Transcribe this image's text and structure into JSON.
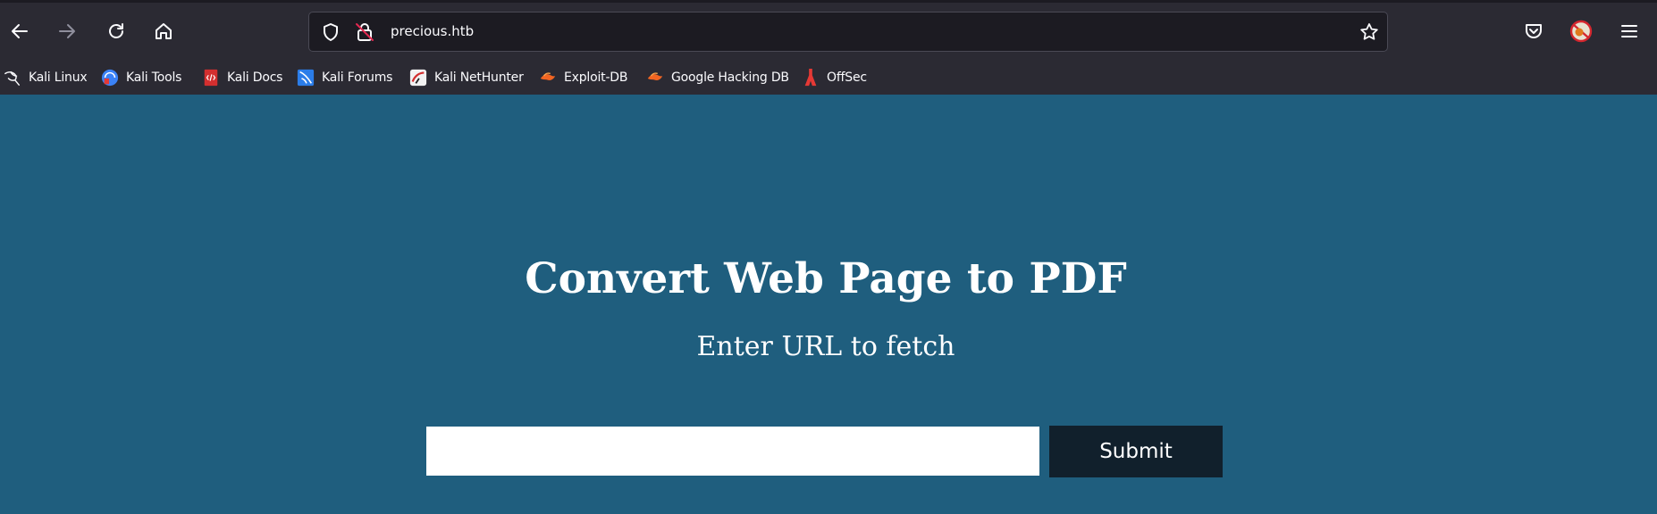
{
  "browser": {
    "url": "precious.htb",
    "icons": {
      "back": "arrow-left-icon",
      "forward": "arrow-right-icon",
      "reload": "reload-icon",
      "home": "home-icon",
      "tracking": "shield-icon",
      "connection": "insecure-lock-icon",
      "bookmark_star": "star-icon",
      "pocket": "pocket-icon",
      "extension": "extension-icon",
      "menu": "hamburger-menu-icon"
    },
    "bookmarks": [
      {
        "label": "Kali Linux",
        "icon": "kali-dragon-icon"
      },
      {
        "label": "Kali Tools",
        "icon": "kali-tools-icon"
      },
      {
        "label": "Kali Docs",
        "icon": "kali-docs-icon"
      },
      {
        "label": "Kali Forums",
        "icon": "kali-forums-icon"
      },
      {
        "label": "Kali NetHunter",
        "icon": "kali-nethunter-icon"
      },
      {
        "label": "Exploit-DB",
        "icon": "exploit-db-icon"
      },
      {
        "label": "Google Hacking DB",
        "icon": "ghdb-icon"
      },
      {
        "label": "OffSec",
        "icon": "offsec-icon"
      }
    ]
  },
  "page": {
    "title": "Convert Web Page to PDF",
    "subtitle": "Enter URL to fetch",
    "url_input_value": "",
    "submit_label": "Submit"
  },
  "colors": {
    "page_background": "#1f5e7e",
    "button_background": "#11202c",
    "browser_chrome": "#2b2a33"
  }
}
